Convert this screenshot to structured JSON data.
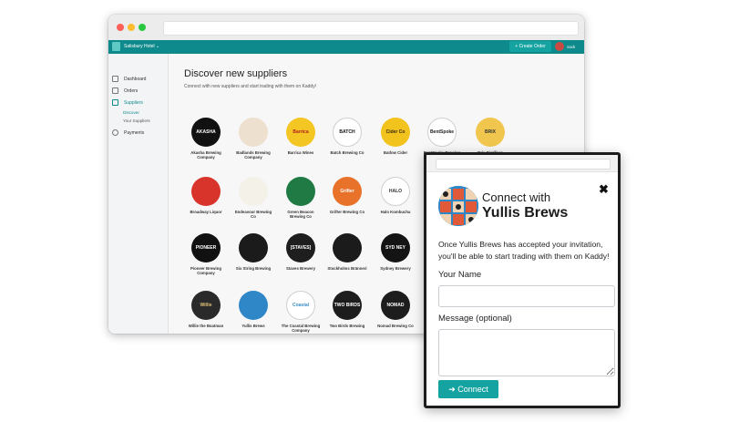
{
  "header": {
    "hotel_selector": "Salisbury Hotel",
    "create_order": "Create Order",
    "user": "zack"
  },
  "sidebar": {
    "items": [
      {
        "label": "Dashboard"
      },
      {
        "label": "Orders"
      },
      {
        "label": "Suppliers"
      },
      {
        "label": "Payments"
      }
    ],
    "subitems": [
      {
        "label": "Discover"
      },
      {
        "label": "Your Suppliers"
      }
    ]
  },
  "main": {
    "title": "Discover new suppliers",
    "subtitle": "Connect with new suppliers and start trading with them on Kaddy!"
  },
  "suppliers": [
    {
      "name": "Akasha Brewing Company",
      "logo_text": "AKASHA",
      "bg": "#111111",
      "fg": "#ffffff"
    },
    {
      "name": "Badlands Brewing Company",
      "logo_text": "",
      "bg": "#eee0cf",
      "fg": "#6b4a2e"
    },
    {
      "name": "Barrica Wines",
      "logo_text": "Barrica",
      "bg": "#f3c623",
      "fg": "#b3201c"
    },
    {
      "name": "Batch Brewing Co",
      "logo_text": "BATCH",
      "bg": "#ffffff",
      "fg": "#111111"
    },
    {
      "name": "Batlow Cider",
      "logo_text": "Cider Co",
      "bg": "#f2c31c",
      "fg": "#3c2a12"
    },
    {
      "name": "BentSpoke Brewing Co",
      "logo_text": "BentSpoke",
      "bg": "#ffffff",
      "fg": "#222222"
    },
    {
      "name": "Brix Distillers",
      "logo_text": "BRIX",
      "bg": "#f1c64e",
      "fg": "#333333"
    },
    {
      "name": "Broadway Liquor",
      "logo_text": "",
      "bg": "#d9342b",
      "fg": "#f4c425"
    },
    {
      "name": "Endeavour Brewing Co",
      "logo_text": "",
      "bg": "#f4f1e8",
      "fg": "#333333"
    },
    {
      "name": "Green Beacon Brewing Co",
      "logo_text": "",
      "bg": "#1f7a43",
      "fg": "#ffffff"
    },
    {
      "name": "Grifter Brewing Co",
      "logo_text": "Grifter",
      "bg": "#e8722a",
      "fg": "#ffffff"
    },
    {
      "name": "Halo Kombucha",
      "logo_text": "HALO",
      "bg": "#ffffff",
      "fg": "#333333"
    },
    {
      "name": "Pioneer Brewing Company",
      "logo_text": "PIONEER",
      "bg": "#111111",
      "fg": "#ffffff"
    },
    {
      "name": "Six String Brewing",
      "logo_text": "",
      "bg": "#1b1b1b",
      "fg": "#ffffff"
    },
    {
      "name": "Staves Brewery",
      "logo_text": "[STAVES]",
      "bg": "#1e1e1e",
      "fg": "#ffffff"
    },
    {
      "name": "Stockholms Bränneri",
      "logo_text": "",
      "bg": "#1b1b1b",
      "fg": "#ffffff"
    },
    {
      "name": "Sydney Brewery",
      "logo_text": "SYD NEY",
      "bg": "#141414",
      "fg": "#ffffff"
    },
    {
      "name": "Willie the Boatman",
      "logo_text": "Willie",
      "bg": "#2a2a2a",
      "fg": "#e2c278"
    },
    {
      "name": "Yullis Brews",
      "logo_text": "",
      "bg": "#2f87c7",
      "fg": "#ffffff"
    },
    {
      "name": "The Coastal Brewing Company",
      "logo_text": "Coastal",
      "bg": "#ffffff",
      "fg": "#3b8fc4"
    },
    {
      "name": "Two Birds Brewing",
      "logo_text": "TWO BIRDS",
      "bg": "#1d1d1d",
      "fg": "#ffffff"
    },
    {
      "name": "Nomad Brewing Co",
      "logo_text": "NOMAD",
      "bg": "#1d1d1d",
      "fg": "#ffffff"
    }
  ],
  "modal": {
    "title_line1": "Connect with",
    "title_line2": "Yullis Brews",
    "close": "✖",
    "message": "Once Yullis Brews has accepted your invitation, you'll be able to start trading with them on Kaddy!",
    "name_label": "Your Name",
    "name_value": "",
    "message_label": "Message (optional)",
    "message_value": "",
    "connect_label": "➜ Connect"
  },
  "colors": {
    "brand_teal": "#0f8a8c",
    "button_teal": "#14a3a1"
  }
}
